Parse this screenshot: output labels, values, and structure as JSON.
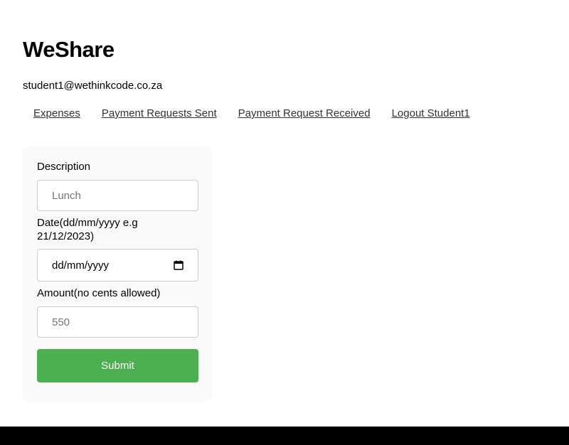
{
  "app": {
    "title": "WeShare",
    "user_email": "student1@wethinkcode.co.za"
  },
  "nav": {
    "items": [
      {
        "label": "Expenses"
      },
      {
        "label": "Payment Requests Sent"
      },
      {
        "label": "Payment Request Received"
      },
      {
        "label": "Logout Student1"
      }
    ]
  },
  "form": {
    "description_label": "Description",
    "description_placeholder": "Lunch",
    "date_label": "Date(dd/mm/yyyy e.g 21/12/2023)",
    "date_value": "dd/mm/yyyy",
    "amount_label": "Amount(no cents allowed)",
    "amount_placeholder": "550",
    "submit_label": "Submit"
  },
  "colors": {
    "submit_button": "#4caf50",
    "footer": "#000000",
    "card_background": "#fafafa"
  },
  "icons": {
    "date_picker": "calendar-icon"
  }
}
